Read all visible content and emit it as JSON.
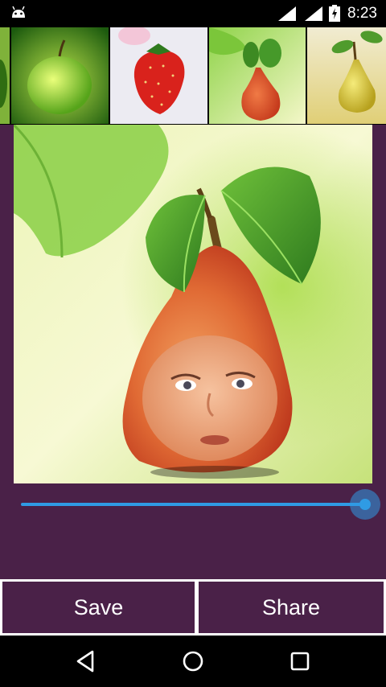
{
  "status_bar": {
    "time": "8:23",
    "icons": [
      "android-debug-icon",
      "signal-icon",
      "signal-icon",
      "battery-charging-icon"
    ]
  },
  "thumbnails": [
    {
      "name": "partial-fruit"
    },
    {
      "name": "green-apple"
    },
    {
      "name": "strawberry"
    },
    {
      "name": "red-pear"
    },
    {
      "name": "yellow-pear"
    }
  ],
  "editor": {
    "image": "pear-face-composite",
    "slider": {
      "value": 1.0
    }
  },
  "actions": {
    "save_label": "Save",
    "share_label": "Share"
  },
  "nav": {
    "buttons": [
      "back-icon",
      "home-icon",
      "recents-icon"
    ]
  },
  "colors": {
    "app_background": "#4a2148",
    "accent": "#2f9be4"
  }
}
